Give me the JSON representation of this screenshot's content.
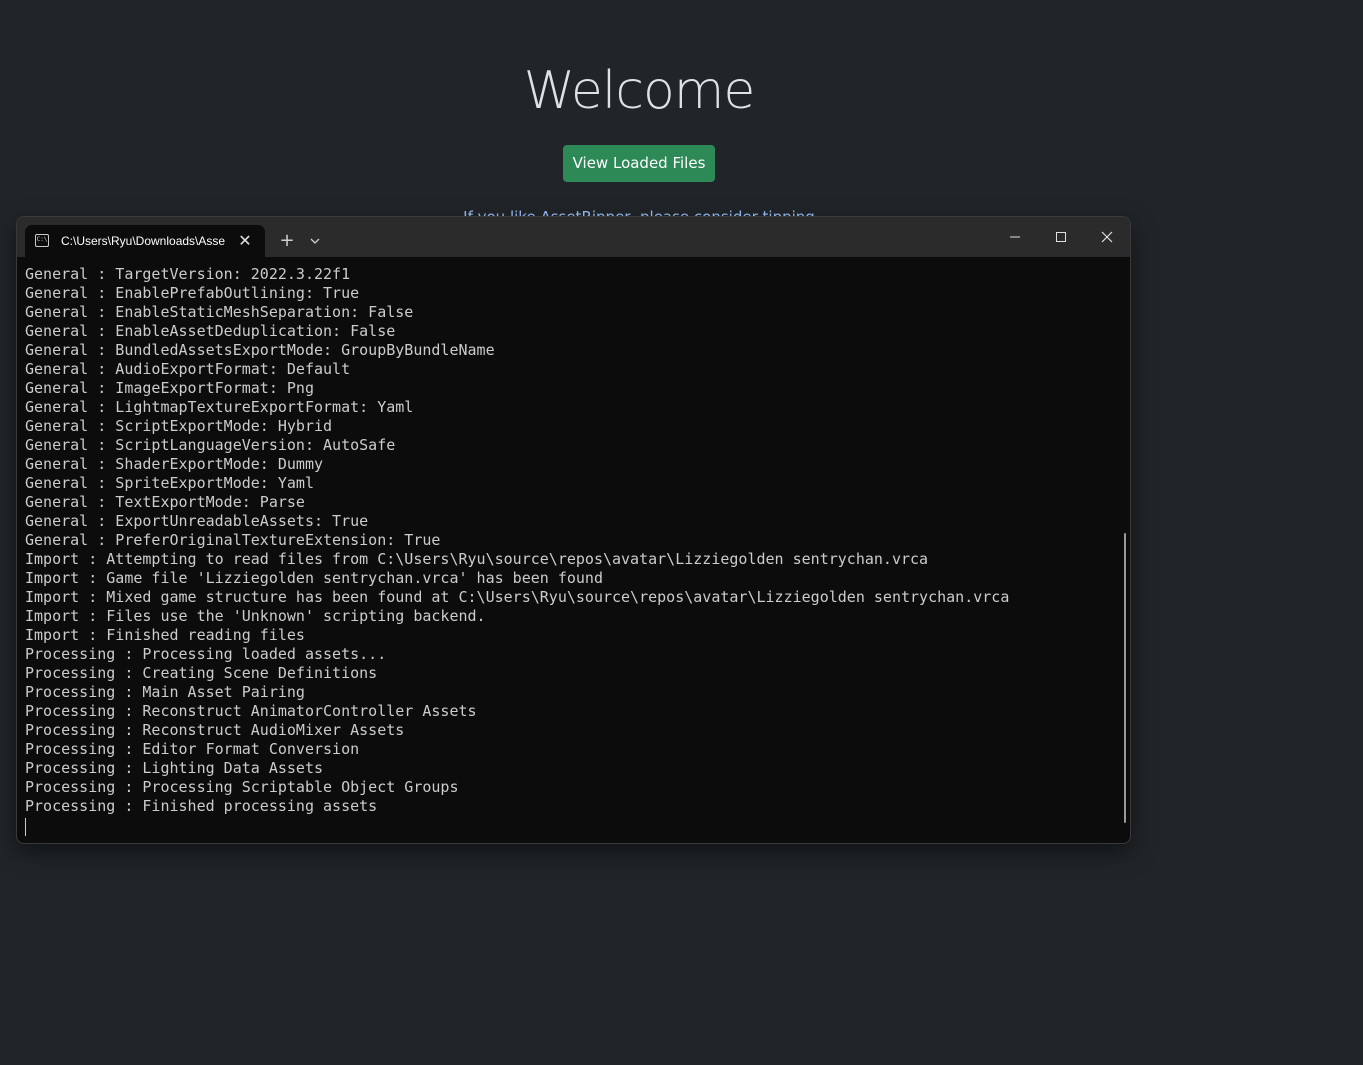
{
  "page": {
    "heading": "Welcome",
    "view_loaded_files_label": "View Loaded Files",
    "partial_text": "If you like AssetRipper, please consider tipping"
  },
  "terminal": {
    "tab_title": "C:\\Users\\Ryu\\Downloads\\Assetl",
    "tab_icon_text": "C:\\",
    "new_tab_label": "+",
    "tab_close_label": "✕",
    "lines": [
      "General : TargetVersion: 2022.3.22f1",
      "General : EnablePrefabOutlining: True",
      "General : EnableStaticMeshSeparation: False",
      "General : EnableAssetDeduplication: False",
      "General : BundledAssetsExportMode: GroupByBundleName",
      "General : AudioExportFormat: Default",
      "General : ImageExportFormat: Png",
      "General : LightmapTextureExportFormat: Yaml",
      "General : ScriptExportMode: Hybrid",
      "General : ScriptLanguageVersion: AutoSafe",
      "General : ShaderExportMode: Dummy",
      "General : SpriteExportMode: Yaml",
      "General : TextExportMode: Parse",
      "General : ExportUnreadableAssets: True",
      "General : PreferOriginalTextureExtension: True",
      "Import : Attempting to read files from C:\\Users\\Ryu\\source\\repos\\avatar\\Lizziegolden sentrychan.vrca",
      "Import : Game file 'Lizziegolden sentrychan.vrca' has been found",
      "Import : Mixed game structure has been found at C:\\Users\\Ryu\\source\\repos\\avatar\\Lizziegolden sentrychan.vrca",
      "Import : Files use the 'Unknown' scripting backend.",
      "Import : Finished reading files",
      "Processing : Processing loaded assets...",
      "Processing : Creating Scene Definitions",
      "Processing : Main Asset Pairing",
      "Processing : Reconstruct AnimatorController Assets",
      "Processing : Reconstruct AudioMixer Assets",
      "Processing : Editor Format Conversion",
      "Processing : Lighting Data Assets",
      "Processing : Processing Scriptable Object Groups",
      "Processing : Finished processing assets"
    ]
  },
  "colors": {
    "page_background": "#212529",
    "button_green": "#2d8a57",
    "terminal_background": "#0c0c0c",
    "terminal_text": "#cccccc"
  }
}
